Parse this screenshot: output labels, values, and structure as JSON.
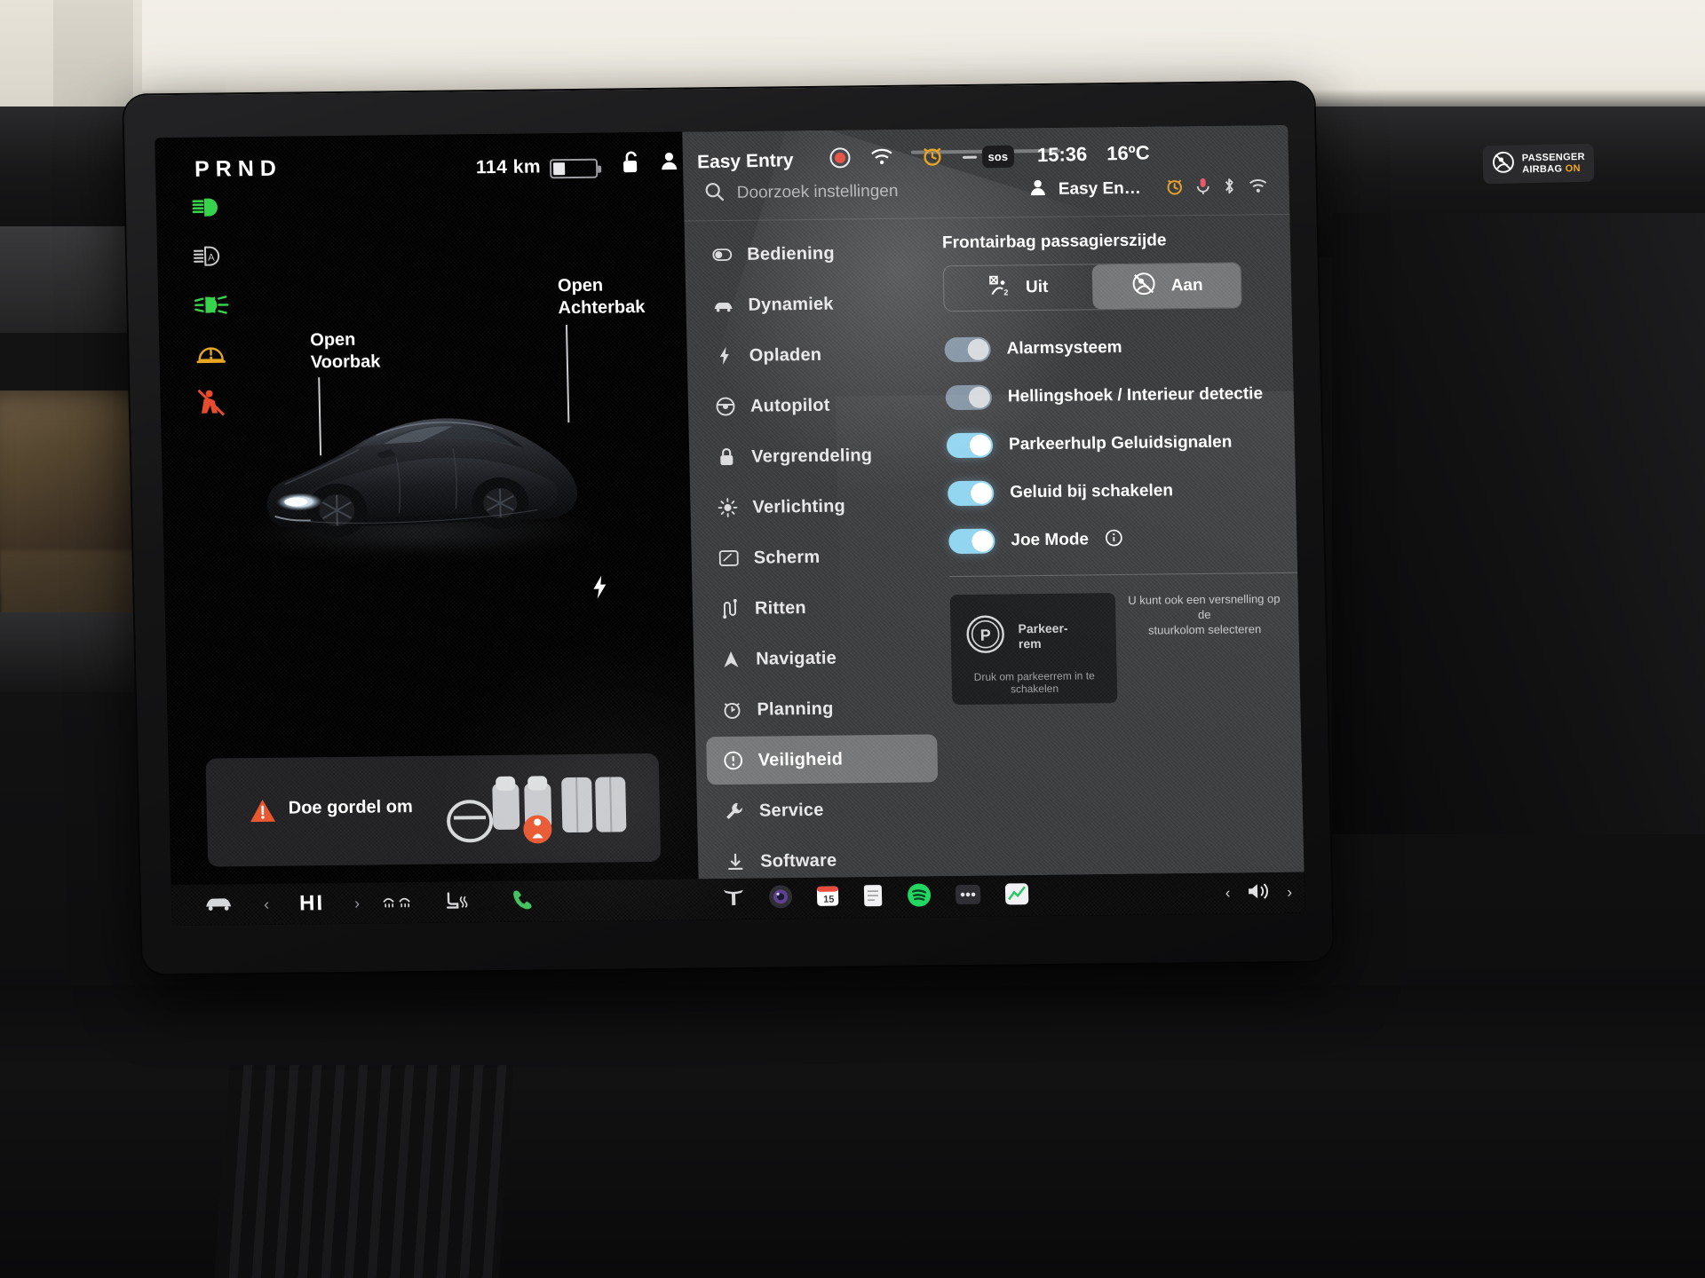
{
  "cluster": {
    "gear_indicator": "PRND",
    "range": "114 km",
    "telltales": [
      {
        "name": "high-beam-icon",
        "color": "#35d24a"
      },
      {
        "name": "auto-high-beam-icon",
        "color": "#c9cacc"
      },
      {
        "name": "fog-light-icon",
        "color": "#35d24a"
      },
      {
        "name": "tire-pressure-icon",
        "color": "#e8a51e"
      },
      {
        "name": "seatbelt-warning-icon",
        "color": "#e8492a"
      }
    ],
    "callouts": {
      "front_trunk": "Open\nVoorbak",
      "front_trunk_l1": "Open",
      "front_trunk_l2": "Voorbak",
      "rear_trunk_l1": "Open",
      "rear_trunk_l2": "Achterbak"
    },
    "belt_warning": {
      "text": "Doe gordel om",
      "icon": "warning-triangle-icon"
    }
  },
  "statusbar": {
    "lock_icon": "unlock-icon",
    "profile_icon": "person-icon",
    "profile_name": "Easy Entry",
    "record_icon": "record-dot-icon",
    "wifi_icon": "wifi-icon",
    "alarm_icon": "alarm-clock-icon",
    "sos_label": "sos",
    "time": "15:36",
    "temperature": "16ºC",
    "airbag_badge": {
      "line1": "PASSENGER",
      "line2_a": "AIRBAG",
      "line2_b": "ON",
      "on_color": "#f0a71e"
    }
  },
  "settings": {
    "search": {
      "placeholder": "Doorzoek instellingen",
      "icon": "search-icon"
    },
    "profile_short": "Easy En…",
    "top_icons": [
      "person-icon",
      "alarm-clock-icon",
      "microphone-icon",
      "bluetooth-icon",
      "wifi-icon"
    ],
    "nav": [
      {
        "label": "Bediening",
        "icon": "toggle-icon",
        "active": false
      },
      {
        "label": "Dynamiek",
        "icon": "car-icon",
        "active": false
      },
      {
        "label": "Opladen",
        "icon": "bolt-icon",
        "active": false
      },
      {
        "label": "Autopilot",
        "icon": "steering-wheel-icon",
        "active": false
      },
      {
        "label": "Vergrendeling",
        "icon": "lock-icon",
        "active": false
      },
      {
        "label": "Verlichting",
        "icon": "sun-icon",
        "active": false
      },
      {
        "label": "Scherm",
        "icon": "display-icon",
        "active": false
      },
      {
        "label": "Ritten",
        "icon": "route-icon",
        "active": false
      },
      {
        "label": "Navigatie",
        "icon": "navigation-arrow-icon",
        "active": false
      },
      {
        "label": "Planning",
        "icon": "schedule-clock-icon",
        "active": false
      },
      {
        "label": "Veiligheid",
        "icon": "exclamation-circle-icon",
        "active": true
      },
      {
        "label": "Service",
        "icon": "wrench-icon",
        "active": false
      },
      {
        "label": "Software",
        "icon": "download-icon",
        "active": false
      }
    ],
    "airbag_section": {
      "title": "Frontairbag passagierszijde",
      "options": [
        {
          "label": "Uit",
          "icon": "airbag-off-icon",
          "selected": false
        },
        {
          "label": "Aan",
          "icon": "airbag-on-icon",
          "selected": true
        }
      ]
    },
    "toggles": [
      {
        "label": "Alarmsysteem",
        "on": true,
        "dim": true
      },
      {
        "label": "Hellingshoek / Interieur detectie",
        "on": true,
        "dim": true
      },
      {
        "label": "Parkeerhulp Geluidsignalen",
        "on": true,
        "dim": false
      },
      {
        "label": "Geluid bij schakelen",
        "on": true,
        "dim": false
      },
      {
        "label": "Joe Mode",
        "on": true,
        "dim": false,
        "info_icon": "info-circle-icon"
      }
    ],
    "parking_brake": {
      "icon": "p-brake-icon",
      "label_l1": "Parkeer-",
      "label_l2": "rem",
      "note": "Druk om parkeerrem in te schakelen",
      "side_note_l1": "U kunt ook een versnelling op de",
      "side_note_l2": "stuurkolom selecteren"
    }
  },
  "dock": {
    "apps": [
      {
        "name": "tesla-logo-icon"
      },
      {
        "name": "camera-icon"
      },
      {
        "name": "calendar-icon",
        "badge": "15"
      },
      {
        "name": "notes-icon"
      },
      {
        "name": "spotify-icon"
      },
      {
        "name": "more-dots-icon"
      },
      {
        "name": "energy-chart-icon"
      }
    ],
    "volume": {
      "prev_icon": "chevron-left-icon",
      "speaker_icon": "speaker-icon",
      "next_icon": "chevron-right-icon"
    }
  },
  "controlbar": {
    "car_icon": "car-front-icon",
    "left_arrow": "‹",
    "fan_label": "HI",
    "right_arrow": "›",
    "defrost_icon": "defrost-icon",
    "seat_heater_icon": "seat-heater-icon",
    "phone_icon": "phone-icon"
  }
}
